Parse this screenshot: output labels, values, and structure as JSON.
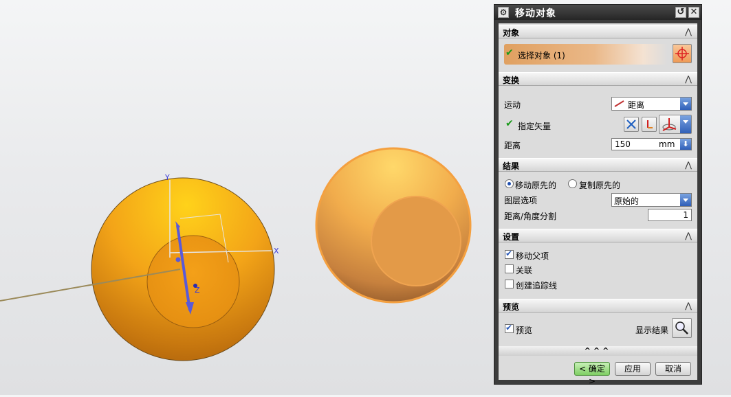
{
  "viewport": {
    "axis_labels": {
      "x": "X",
      "y": "Y",
      "z": "Z"
    }
  },
  "dialog": {
    "title": "移动对象",
    "sections": {
      "objects": {
        "header": "对象",
        "select_label": "选择对象 (1)"
      },
      "transform": {
        "header": "变换",
        "motion_label": "运动",
        "motion_value": "距离",
        "vector_label": "指定矢量",
        "distance_label": "距离",
        "distance_value": "150",
        "distance_unit": "mm"
      },
      "result": {
        "header": "结果",
        "radio_move": "移动原先的",
        "radio_copy": "复制原先的",
        "selected_radio": "移动原先的",
        "layer_label": "图层选项",
        "layer_value": "原始的",
        "split_label": "距离/角度分割",
        "split_value": "1"
      },
      "settings": {
        "header": "设置",
        "items": [
          {
            "label": "移动父项",
            "checked": true
          },
          {
            "label": "关联",
            "checked": false
          },
          {
            "label": "创建追踪线",
            "checked": false
          }
        ]
      },
      "preview": {
        "header": "预览",
        "preview_label": "预览",
        "preview_checked": true,
        "show_result_label": "显示结果"
      }
    },
    "more_chevrons": "^^^",
    "buttons": {
      "ok": "< 确定 >",
      "apply": "应用",
      "cancel": "取消"
    }
  },
  "colors": {
    "accent_orange": "#f0a020",
    "axis_blue": "#5a5ad8",
    "ok_green": "#7fcf63"
  }
}
